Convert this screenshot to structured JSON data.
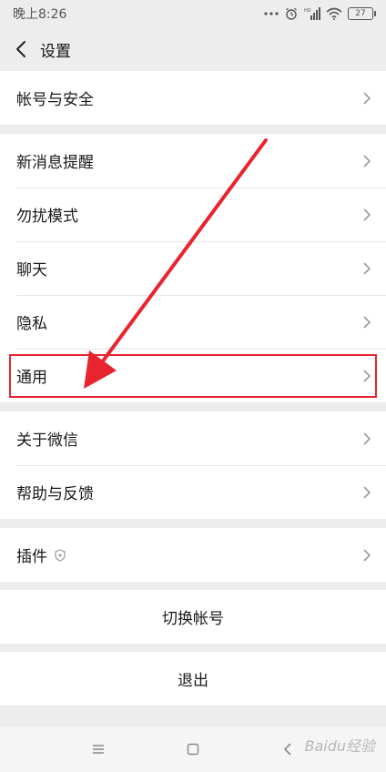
{
  "status": {
    "time": "晚上8:26",
    "network": "HD",
    "battery": "27"
  },
  "header": {
    "title": "设置"
  },
  "groups": [
    {
      "items": [
        {
          "label": "帐号与安全"
        }
      ]
    },
    {
      "items": [
        {
          "label": "新消息提醒"
        },
        {
          "label": "勿扰模式"
        },
        {
          "label": "聊天"
        },
        {
          "label": "隐私"
        },
        {
          "label": "通用"
        }
      ]
    },
    {
      "items": [
        {
          "label": "关于微信"
        },
        {
          "label": "帮助与反馈"
        }
      ]
    },
    {
      "items": [
        {
          "label": "插件"
        }
      ]
    }
  ],
  "actions": {
    "switch_account": "切换帐号",
    "logout": "退出"
  },
  "watermark": "Baidu经验",
  "colors": {
    "annotation_red": "#e8242f",
    "background": "#ededed"
  }
}
